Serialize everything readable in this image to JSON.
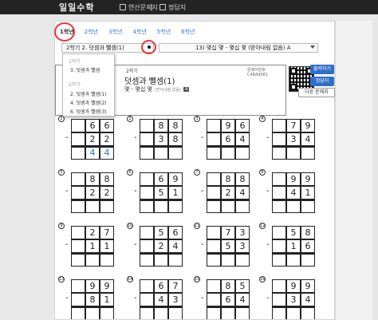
{
  "header": {
    "logo": "일일수학",
    "nav": [
      {
        "label": "연산문제지",
        "icon": "document-icon"
      },
      {
        "label": "정답지",
        "icon": "answer-icon"
      }
    ]
  },
  "grade_tabs": [
    "1학년",
    "2학년",
    "3학년",
    "4학년",
    "5학년",
    "6학년"
  ],
  "unit_select": {
    "value": "2학기 2. 덧셈과 뺄셈(1)"
  },
  "lesson_select": {
    "value": "13) 몇십 몇 - 몇십 몇 (받아내림 없음) A"
  },
  "dropdown": {
    "groups": [
      {
        "title": "1학기",
        "items": [
          "3. 덧셈과 뺄셈"
        ]
      },
      {
        "title": "2학기",
        "items": [
          "2. 덧셈과 뺄셈(1)",
          "4. 덧셈과 뺄셈(2)",
          "6. 덧셈과 뺄셈(3)"
        ]
      }
    ]
  },
  "worksheet": {
    "term": "2학기",
    "title": "덧셈과 뺄셈(1)",
    "subtitle": "몇 - 몇십 몇",
    "note": "(받아내림 없음)",
    "badge": "A",
    "code": "문제지번호 C48A9081"
  },
  "buttons": {
    "print": "출력하기",
    "answers": "정답지",
    "other": "다른 문제지"
  },
  "colors": {
    "accent": "#2f6fc6",
    "answer_digits": "#2f74c8",
    "annotation": "#e83838"
  },
  "problems": [
    {
      "num": "1",
      "a": [
        "6",
        "6"
      ],
      "b": [
        "2",
        "2"
      ],
      "ans": [
        "4",
        "4"
      ]
    },
    {
      "num": "2",
      "a": [
        "8",
        "8"
      ],
      "b": [
        "3",
        "8"
      ],
      "ans": [
        "",
        ""
      ]
    },
    {
      "num": "3",
      "a": [
        "9",
        "6"
      ],
      "b": [
        "6",
        "4"
      ],
      "ans": [
        "",
        ""
      ]
    },
    {
      "num": "4",
      "a": [
        "7",
        "9"
      ],
      "b": [
        "3",
        "4"
      ],
      "ans": [
        "",
        ""
      ]
    },
    {
      "num": "5",
      "a": [
        "8",
        "8"
      ],
      "b": [
        "2",
        "2"
      ],
      "ans": [
        "",
        ""
      ]
    },
    {
      "num": "6",
      "a": [
        "6",
        "9"
      ],
      "b": [
        "5",
        "1"
      ],
      "ans": [
        "",
        ""
      ]
    },
    {
      "num": "7",
      "a": [
        "8",
        "8"
      ],
      "b": [
        "2",
        "4"
      ],
      "ans": [
        "",
        ""
      ]
    },
    {
      "num": "8",
      "a": [
        "9",
        "9"
      ],
      "b": [
        "4",
        "1"
      ],
      "ans": [
        "",
        ""
      ]
    },
    {
      "num": "9",
      "a": [
        "2",
        "7"
      ],
      "b": [
        "1",
        "1"
      ],
      "ans": [
        "",
        ""
      ]
    },
    {
      "num": "10",
      "a": [
        "5",
        "6"
      ],
      "b": [
        "2",
        "4"
      ],
      "ans": [
        "",
        ""
      ]
    },
    {
      "num": "11",
      "a": [
        "7",
        "3"
      ],
      "b": [
        "5",
        "3"
      ],
      "ans": [
        "",
        ""
      ]
    },
    {
      "num": "12",
      "a": [
        "5",
        "8"
      ],
      "b": [
        "1",
        "6"
      ],
      "ans": [
        "",
        ""
      ]
    },
    {
      "num": "13",
      "a": [
        "9",
        "9"
      ],
      "b": [
        "8",
        "1"
      ],
      "ans": [
        "",
        ""
      ]
    },
    {
      "num": "14",
      "a": [
        "6",
        "7"
      ],
      "b": [
        "4",
        "3"
      ],
      "ans": [
        "",
        ""
      ]
    },
    {
      "num": "15",
      "a": [
        "8",
        "5"
      ],
      "b": [
        "6",
        "4"
      ],
      "ans": [
        "",
        ""
      ]
    },
    {
      "num": "16",
      "a": [
        "9",
        "9"
      ],
      "b": [
        "3",
        "4"
      ],
      "ans": [
        "",
        ""
      ]
    }
  ]
}
